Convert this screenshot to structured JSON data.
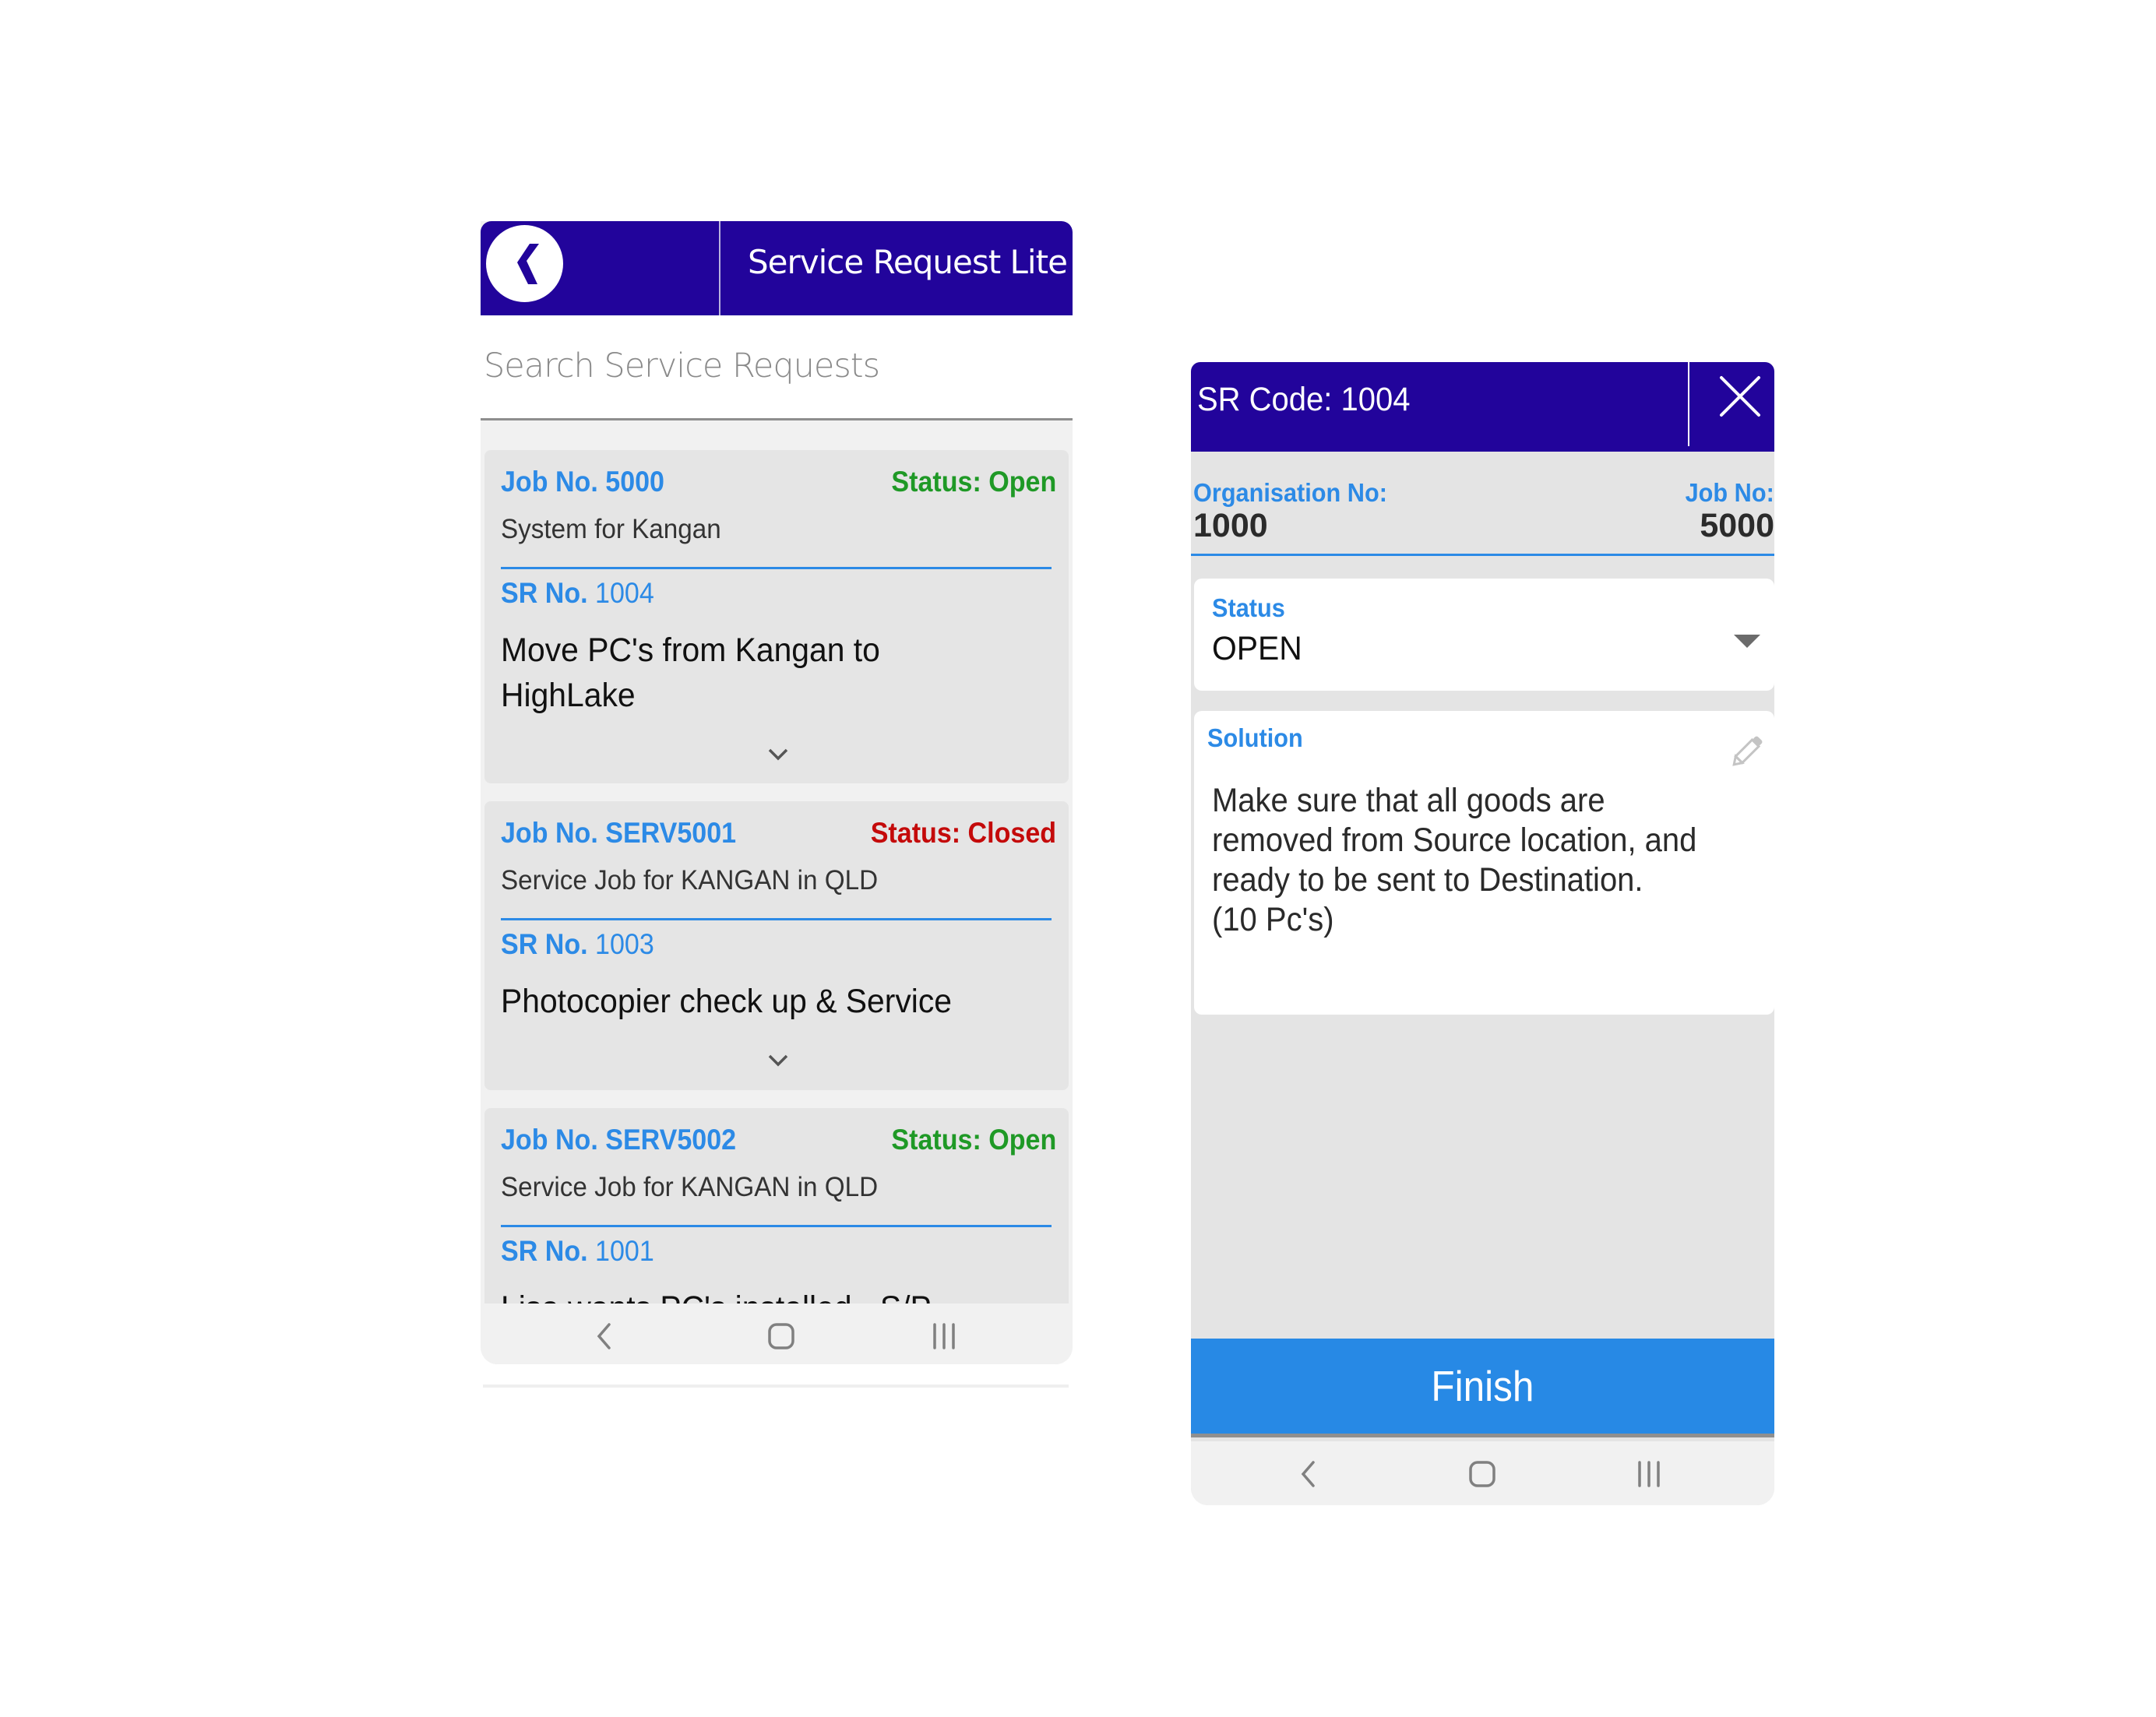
{
  "list_screen": {
    "header": {
      "back_icon": "back-chevron-icon",
      "title": "Service Request Lite",
      "brand_color": "#22049b"
    },
    "search": {
      "placeholder": "Search Service Requests",
      "value": ""
    },
    "cards": [
      {
        "job_label": "Job No. 5000",
        "status_label": "Status: Open",
        "status": "open",
        "subtitle": "System for Kangan",
        "sr_label": "SR No.",
        "sr_number": "1004",
        "description": "Move PC's from Kangan to HighLake",
        "expand_icon": "chevron-down-icon"
      },
      {
        "job_label": "Job No. SERV5001",
        "status_label": "Status: Closed",
        "status": "closed",
        "subtitle": "Service Job for KANGAN in QLD",
        "sr_label": "SR No.",
        "sr_number": "1003",
        "description": "Photocopier check up & Service",
        "expand_icon": "chevron-down-icon"
      },
      {
        "job_label": "Job No. SERV5002",
        "status_label": "Status: Open",
        "status": "open",
        "subtitle": "Service Job for KANGAN in QLD",
        "sr_label": "SR No.",
        "sr_number": "1001",
        "description": "Lisa wants PC's installed - S/P"
      }
    ],
    "colors": {
      "accent": "#2c8ae6",
      "status_open": "#1f9926",
      "status_closed": "#c40a0a"
    }
  },
  "detail_screen": {
    "header": {
      "title": "SR Code: 1004",
      "close_icon": "close-icon"
    },
    "info": {
      "org_label": "Organisation No:",
      "org_value": "1000",
      "job_label": "Job No:",
      "job_value": "5000"
    },
    "status_field": {
      "label": "Status",
      "value": "OPEN",
      "dropdown_icon": "dropdown-arrow-icon"
    },
    "solution_field": {
      "label": "Solution",
      "value": "Make sure that all goods are removed from Source location, and ready to be sent to Destination.\n(10 Pc's)",
      "edit_icon": "pencil-icon"
    },
    "finish_label": "Finish",
    "colors": {
      "finish_button": "#2789e5"
    }
  },
  "system_nav": {
    "back_icon": "nav-back-icon",
    "home_icon": "nav-home-icon",
    "recents_icon": "nav-recents-icon"
  }
}
